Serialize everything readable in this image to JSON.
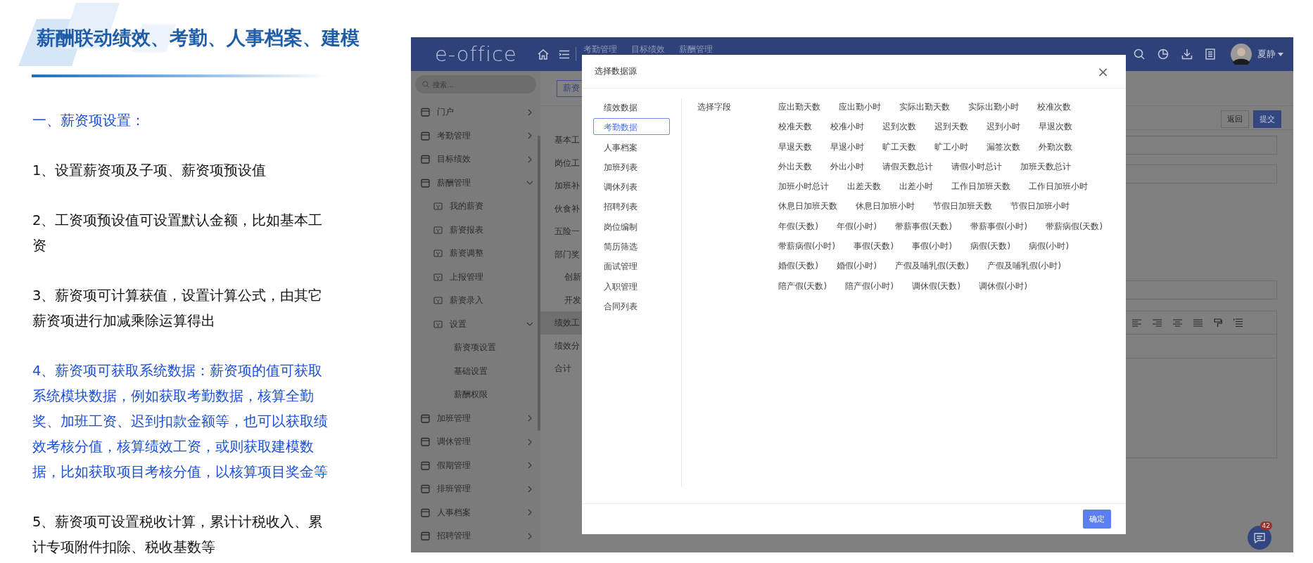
{
  "slide": {
    "title": "薪酬联动绩效、考勤、人事档案、建模",
    "paragraphs": [
      {
        "kind": "heading",
        "text": "一、薪资项设置："
      },
      {
        "kind": "point",
        "emphasis": false,
        "text": "1、设置薪资项及子项、薪资项预设值"
      },
      {
        "kind": "point",
        "emphasis": false,
        "text": "2、工资项预设值可设置默认金额，比如基本工资"
      },
      {
        "kind": "point",
        "emphasis": false,
        "text": "3、薪资项可计算获值，设置计算公式，由其它薪资项进行加减乘除运算得出"
      },
      {
        "kind": "point",
        "emphasis": true,
        "text": "4、薪资项可获取系统数据：薪资项的值可获取系统模块数据，例如获取考勤数据，核算全勤奖、加班工资、迟到扣款金额等，也可以获取绩效考核分值，核算绩效工资，或则获取建模数据，比如获取项目考核分值，以核算项目奖金等"
      },
      {
        "kind": "point",
        "emphasis": false,
        "text": "5、薪资项可设置税收计算，累计计税收入、累计专项附件扣除、税收基数等"
      }
    ]
  },
  "app": {
    "logo": "e-office",
    "nav": [
      "考勤管理",
      "目标绩效",
      "薪酬管理"
    ],
    "user": "夏静",
    "search": {
      "placeholder": "搜索..."
    },
    "sidebar": [
      {
        "label": "门户",
        "expanded": false
      },
      {
        "label": "考勤管理",
        "expanded": false
      },
      {
        "label": "目标绩效",
        "expanded": false
      },
      {
        "label": "薪酬管理",
        "expanded": true,
        "children": [
          {
            "label": "我的薪资"
          },
          {
            "label": "薪资报表"
          },
          {
            "label": "薪资调整"
          },
          {
            "label": "上报管理"
          },
          {
            "label": "薪资录入"
          },
          {
            "label": "设置",
            "expanded": true,
            "children": [
              {
                "label": "薪资项设置"
              },
              {
                "label": "基础设置"
              },
              {
                "label": "薪酬权限"
              }
            ]
          }
        ]
      },
      {
        "label": "加班管理",
        "expanded": false
      },
      {
        "label": "调休管理",
        "expanded": false
      },
      {
        "label": "假期管理",
        "expanded": false
      },
      {
        "label": "排班管理",
        "expanded": false
      },
      {
        "label": "人事档案",
        "expanded": false
      },
      {
        "label": "招聘管理",
        "expanded": false
      }
    ],
    "tab_button": "薪资",
    "items": [
      {
        "label": "基本工",
        "selected": false
      },
      {
        "label": "岗位工",
        "selected": false
      },
      {
        "label": "加班补",
        "selected": false
      },
      {
        "label": "伙食补",
        "selected": false
      },
      {
        "label": "五险一",
        "selected": false
      },
      {
        "label": "部门奖",
        "selected": false,
        "children": [
          {
            "label": "创新",
            "selected": false
          },
          {
            "label": "开发",
            "selected": false
          }
        ]
      },
      {
        "label": "绩效工",
        "selected": true
      },
      {
        "label": "绩效分",
        "selected": false
      },
      {
        "label": "合计",
        "selected": false
      }
    ],
    "actions": [
      {
        "kind": "default",
        "label": "返回"
      },
      {
        "kind": "primary",
        "label": "提交"
      }
    ],
    "chat_badge": "42"
  },
  "dialog": {
    "title": "选择数据源",
    "close": "×",
    "field_label": "选择字段",
    "sources": [
      {
        "label": "绩效数据",
        "selected": false
      },
      {
        "label": "考勤数据",
        "selected": true
      },
      {
        "label": "人事档案",
        "selected": false
      },
      {
        "label": "加班列表",
        "selected": false
      },
      {
        "label": "调休列表",
        "selected": false
      },
      {
        "label": "招聘列表",
        "selected": false
      },
      {
        "label": "岗位编制",
        "selected": false
      },
      {
        "label": "简历筛选",
        "selected": false
      },
      {
        "label": "面试管理",
        "selected": false
      },
      {
        "label": "入职管理",
        "selected": false
      },
      {
        "label": "合同列表",
        "selected": false
      }
    ],
    "field_rows": [
      [
        "应出勤天数",
        "应出勤小时",
        "实际出勤天数",
        "实际出勤小时",
        "校准次数"
      ],
      [
        "校准天数",
        "校准小时",
        "迟到次数",
        "迟到天数",
        "迟到小时",
        "早退次数"
      ],
      [
        "早退天数",
        "早退小时",
        "旷工天数",
        "旷工小时",
        "漏签次数",
        "外勤次数"
      ],
      [
        "外出天数",
        "外出小时",
        "请假天数总计",
        "请假小时总计",
        "加班天数总计"
      ],
      [
        "加班小时总计",
        "出差天数",
        "出差小时",
        "工作日加班天数",
        "工作日加班小时"
      ],
      [
        "休息日加班天数",
        "休息日加班小时",
        "节假日加班天数",
        "节假日加班小时"
      ],
      [
        "年假(天数)",
        "年假(小时)",
        "带薪事假(天数)",
        "带薪事假(小时)",
        "带薪病假(天数)"
      ],
      [
        "带薪病假(小时)",
        "事假(天数)",
        "事假(小时)",
        "病假(天数)",
        "病假(小时)"
      ],
      [
        "婚假(天数)",
        "婚假(小时)",
        "产假及哺乳假(天数)",
        "产假及哺乳假(小时)"
      ],
      [
        "陪产假(天数)",
        "陪产假(小时)",
        "调休假(天数)",
        "调休假(小时)"
      ]
    ],
    "confirm": "确定"
  }
}
